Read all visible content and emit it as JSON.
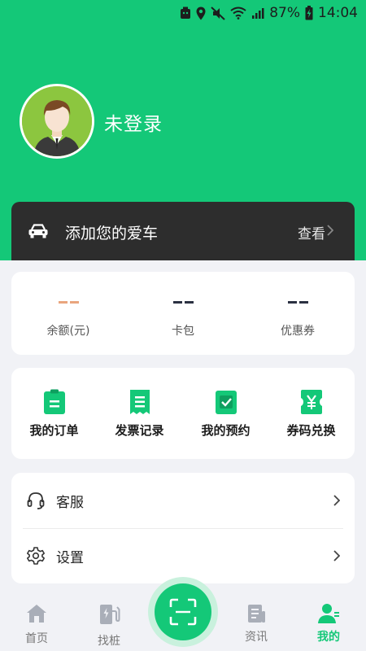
{
  "status_bar": {
    "battery": "87%",
    "time": "14:04"
  },
  "profile": {
    "login_text": "未登录"
  },
  "car_bar": {
    "label": "添加您的爱车",
    "view_label": "查看"
  },
  "stats": [
    {
      "value": "--",
      "label": "余额(元)",
      "color": "#e9a57e"
    },
    {
      "value": "--",
      "label": "卡包",
      "color": "#2b3142"
    },
    {
      "value": "--",
      "label": "优惠券",
      "color": "#2b3142"
    }
  ],
  "quick_actions": [
    {
      "label": "我的订单",
      "icon": "clipboard-icon"
    },
    {
      "label": "发票记录",
      "icon": "receipt-icon"
    },
    {
      "label": "我的预约",
      "icon": "calendar-check-icon"
    },
    {
      "label": "券码兑换",
      "icon": "coupon-yen-icon"
    }
  ],
  "menu": [
    {
      "label": "客服",
      "icon": "headset-icon"
    },
    {
      "label": "设置",
      "icon": "gear-icon"
    }
  ],
  "tabs": [
    {
      "label": "首页",
      "icon": "home-icon",
      "active": false
    },
    {
      "label": "找桩",
      "icon": "charging-pile-icon",
      "active": false
    },
    {
      "label": "资讯",
      "icon": "news-icon",
      "active": false
    },
    {
      "label": "我的",
      "icon": "user-icon",
      "active": true
    }
  ],
  "colors": {
    "brand": "#14c878",
    "dark_bar": "#2d2d2d",
    "background": "#f1f2f6"
  }
}
